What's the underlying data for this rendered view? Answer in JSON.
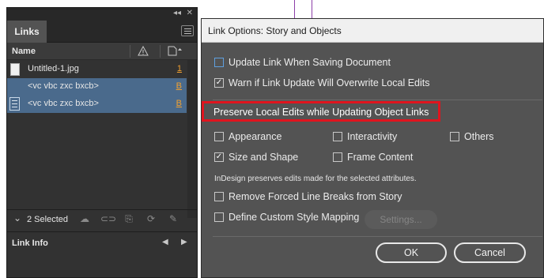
{
  "links_panel": {
    "tab_label": "Links",
    "column_name": "Name",
    "rows": [
      {
        "name": "Untitled-1.jpg",
        "page": "1"
      },
      {
        "name": "<vc vbc zxc bxcb>",
        "page": "B"
      },
      {
        "name": "<vc vbc zxc bxcb>",
        "page": "B"
      }
    ],
    "selected_count": "2 Selected",
    "link_info_label": "Link Info",
    "icons": [
      "collapse-icon",
      "close-icon",
      "panel-menu-icon",
      "warning-icon",
      "page-icon",
      "cloud-icon",
      "relink-icon",
      "goto-link-icon",
      "update-icon",
      "edit-original-icon"
    ]
  },
  "dialog": {
    "title": "Link Options: Story and Objects",
    "update_on_save": {
      "label": "Update Link When Saving Document",
      "checked": false
    },
    "warn_overwrite": {
      "label": "Warn if Link Update Will Overwrite Local Edits",
      "checked": true
    },
    "preserve_heading": "Preserve Local Edits while Updating Object Links",
    "appearance": {
      "label": "Appearance",
      "checked": false
    },
    "interactivity": {
      "label": "Interactivity",
      "checked": false
    },
    "others": {
      "label": "Others",
      "checked": false
    },
    "size_shape": {
      "label": "Size and Shape",
      "checked": true
    },
    "frame_content": {
      "label": "Frame Content",
      "checked": false
    },
    "note": "InDesign preserves edits made for the selected attributes.",
    "remove_breaks": {
      "label": "Remove Forced Line Breaks from Story",
      "checked": false
    },
    "custom_style": {
      "label": "Define Custom Style Mapping",
      "checked": false
    },
    "settings_label": "Settings...",
    "ok_label": "OK",
    "cancel_label": "Cancel",
    "highlight_color": "#e0141e"
  }
}
